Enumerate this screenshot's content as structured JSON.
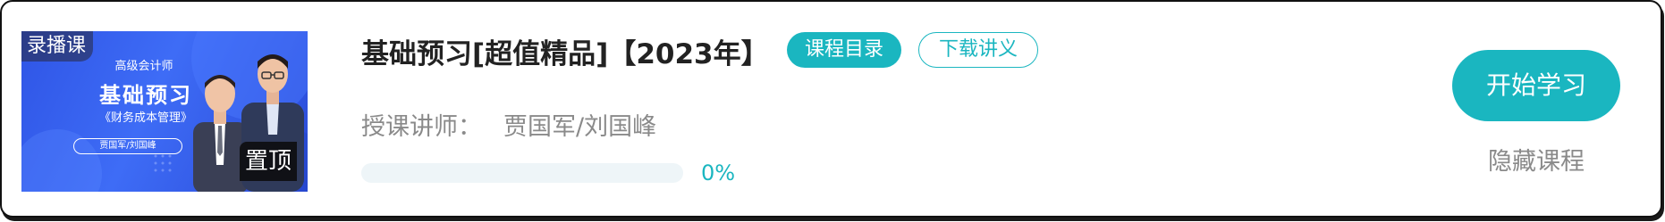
{
  "course": {
    "thumbnail": {
      "live_tag": "录播课",
      "subtitle": "高级会计师",
      "headline": "基础预习",
      "book": "《财务成本管理》",
      "teachers": "贾国军/刘国峰",
      "pin_tag": "置顶",
      "bg_color": "#3e6cf6"
    },
    "title": "基础预习[超值精品]【2023年】",
    "catalog_label": "课程目录",
    "download_label": "下载讲义",
    "teacher_label": "授课讲师：",
    "teacher_names": "贾国军/刘国峰",
    "progress": {
      "value": 0,
      "text": "0%"
    },
    "start_label": "开始学习",
    "hide_label": "隐藏课程",
    "accent_color": "#1ab6c0"
  }
}
